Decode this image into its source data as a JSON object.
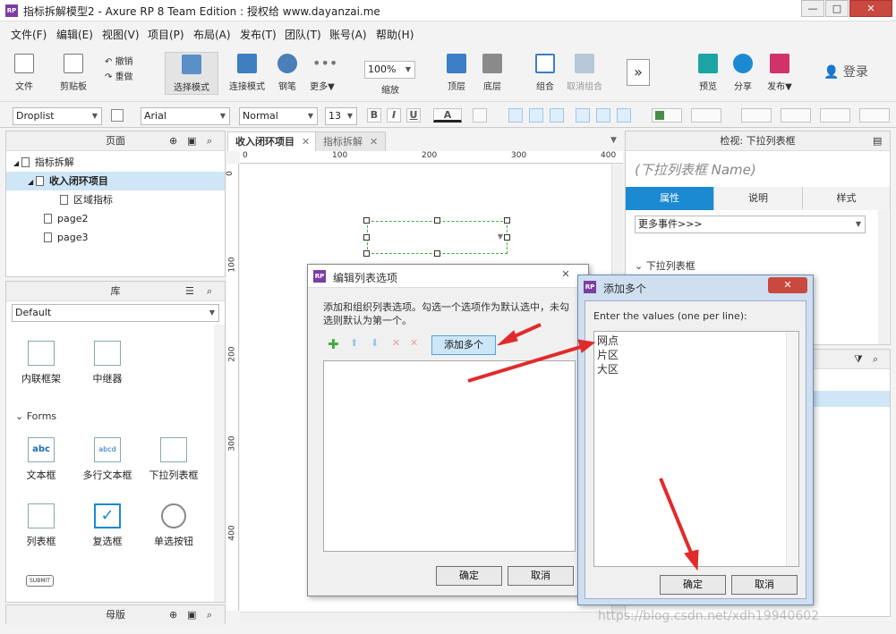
{
  "window": {
    "title": "指标拆解模型2 - Axure RP 8 Team Edition : 授权给 www.dayanzai.me",
    "app_icon": "RP",
    "minimize": "—",
    "maximize": "□",
    "close": "✕"
  },
  "menu": [
    "文件(F)",
    "编辑(E)",
    "视图(V)",
    "项目(P)",
    "布局(A)",
    "发布(T)",
    "团队(T)",
    "账号(A)",
    "帮助(H)"
  ],
  "toolbar": {
    "file": "文件",
    "clipboard": "剪贴板",
    "undo": "撤销",
    "redo": "重做",
    "select_mode": "选择模式",
    "connect_mode": "连接模式",
    "pen": "钢笔",
    "more": "更多▼",
    "zoom_value": "100%",
    "zoom_label": "缩放",
    "top": "顶层",
    "bottom": "底层",
    "group": "组合",
    "ungroup": "取消组合",
    "expand": "»",
    "preview": "预览",
    "share": "分享",
    "publish": "发布▼",
    "login": "登录"
  },
  "format": {
    "widget_type": "Droplist",
    "font": "Arial",
    "style": "Normal",
    "size": "13",
    "bold": "B",
    "italic": "I",
    "underline": "U",
    "text_color": "A"
  },
  "pages_panel": {
    "title": "页面",
    "items": [
      {
        "label": "指标拆解"
      },
      {
        "label": "收入闭环项目"
      },
      {
        "label": "区域指标"
      },
      {
        "label": "page2"
      },
      {
        "label": "page3"
      }
    ]
  },
  "library_panel": {
    "title": "库",
    "selected": "Default",
    "items_top": [
      "内联框架",
      "中继器"
    ],
    "section": "Forms",
    "forms": [
      "文本框",
      "多行文本框",
      "下拉列表框",
      "列表框",
      "复选框",
      "单选按钮"
    ],
    "submit": "SUBMIT",
    "icon_labels": {
      "textbox": "abc",
      "textarea": "abcd"
    }
  },
  "masters_panel": {
    "title": "母版"
  },
  "tabs": [
    {
      "label": "收入闭环项目"
    },
    {
      "label": "指标拆解"
    }
  ],
  "ruler": {
    "h_ticks": [
      "0",
      "100",
      "200",
      "300",
      "400"
    ],
    "v_ticks": [
      "0",
      "100",
      "200",
      "300",
      "400"
    ]
  },
  "inspector": {
    "title": "检视: 下拉列表框",
    "name_placeholder": "(下拉列表框 Name)",
    "tabs": [
      "属性",
      "说明",
      "样式"
    ],
    "more_events": "更多事件>>>",
    "section": "下拉列表框"
  },
  "edit_dialog": {
    "icon": "RP",
    "title": "编辑列表选项",
    "description": "添加和组织列表选项。勾选一个选项作为默认选中，未勾选则默认为第一个。",
    "add_multiple": "添加多个",
    "ok": "确定",
    "cancel": "取消",
    "close": "✕"
  },
  "add_dialog": {
    "icon": "RP",
    "title": "添加多个",
    "prompt": "Enter the values (one per line):",
    "values": "网点\n片区\n大区",
    "ok": "确定",
    "cancel": "取消",
    "close": "✕"
  },
  "watermark": "https://blog.csdn.net/xdh19940602",
  "colors": {
    "accent_blue": "#1b8ad3",
    "arrow_red": "#e12b2b",
    "selection": "#cfe6f7"
  }
}
